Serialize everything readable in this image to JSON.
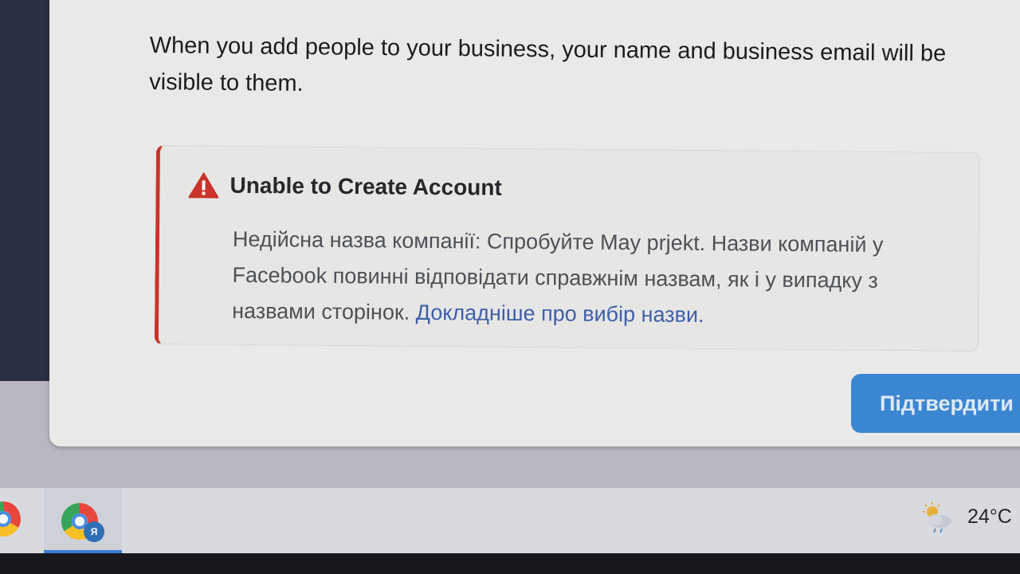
{
  "dialog": {
    "intro_text": "When you add people to your business, your name and business email will be visible to them."
  },
  "error": {
    "icon": "warning-icon",
    "title": "Unable to Create Account",
    "message": "Недійсна назва компанії: Спробуйте May prjekt. Назви компаній у Facebook повинні відповідати справжнім назвам, як і у випадку з назвами сторінок. ",
    "link_text": "Докладніше про вибір назви.",
    "accent_color": "#c9332b"
  },
  "actions": {
    "confirm_label": "Підтвердити",
    "confirm_color": "#3b86d1"
  },
  "taskbar": {
    "profile_badge": "Я",
    "weather_icon": "weather-cloud-sun-icon",
    "temperature": "24°C"
  }
}
